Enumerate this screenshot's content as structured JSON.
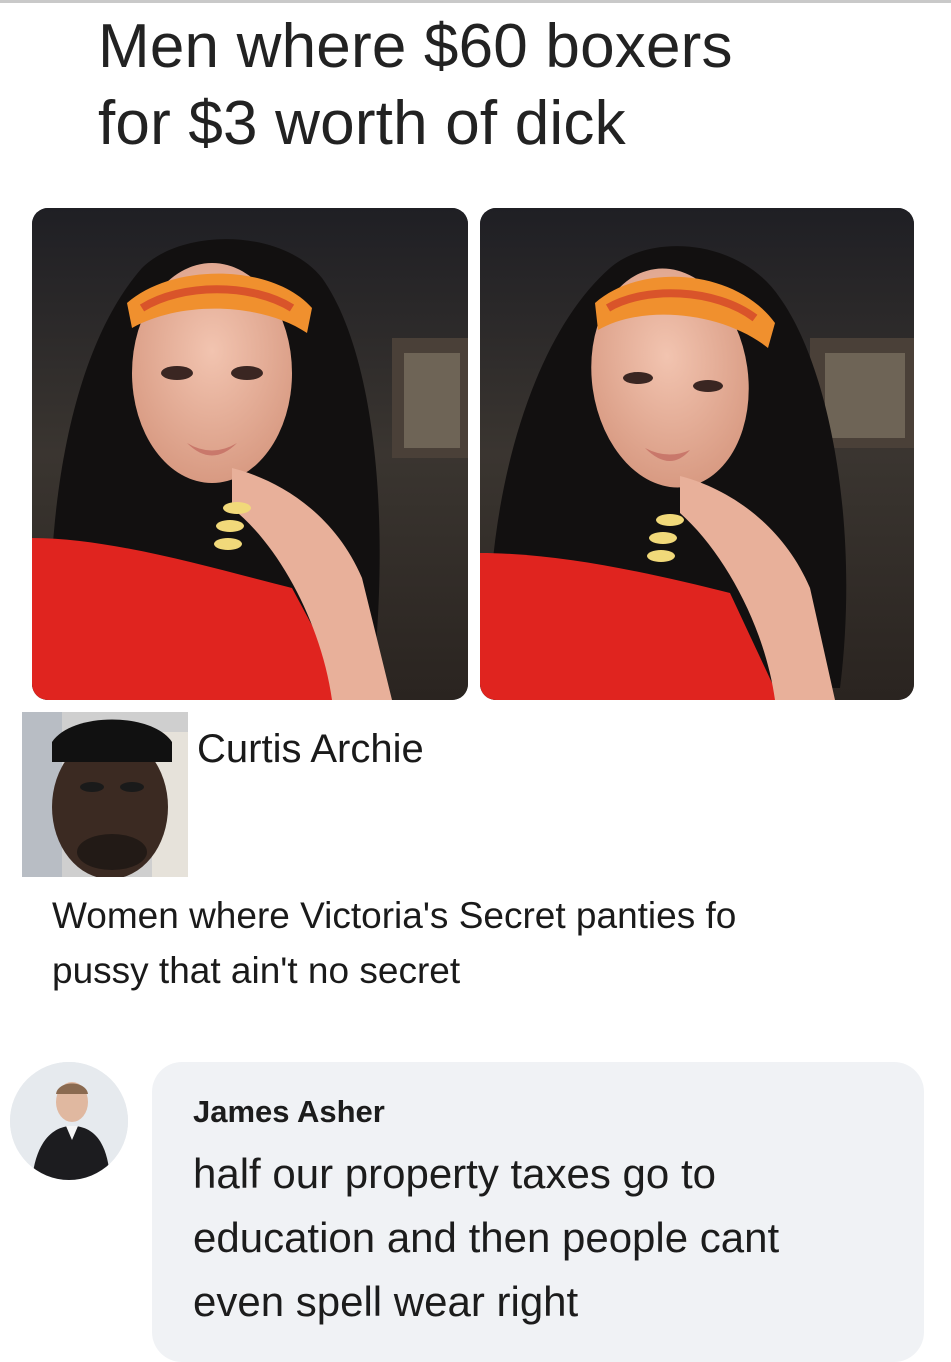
{
  "post": {
    "title_line1": "Men where $60 boxers",
    "title_line2": "for $3 worth of dick"
  },
  "photos": [
    {
      "icon": "woman-photo-1"
    },
    {
      "icon": "woman-photo-2"
    }
  ],
  "comment_1": {
    "author": "Curtis Archie",
    "avatar_icon": "man-avatar",
    "text_line1": "Women where Victoria's Secret panties fo",
    "text_line2": "pussy that ain't no secret"
  },
  "comment_2": {
    "author": "James Asher",
    "avatar_icon": "person-avatar",
    "text_line1": "half our property taxes go to",
    "text_line2": "education and then people cant",
    "text_line3": "even spell wear right"
  },
  "colors": {
    "bubble": "#f0f2f5",
    "text": "#1c1c1c",
    "shirt_red": "#e0241f",
    "headband_orange": "#f08a2a"
  }
}
